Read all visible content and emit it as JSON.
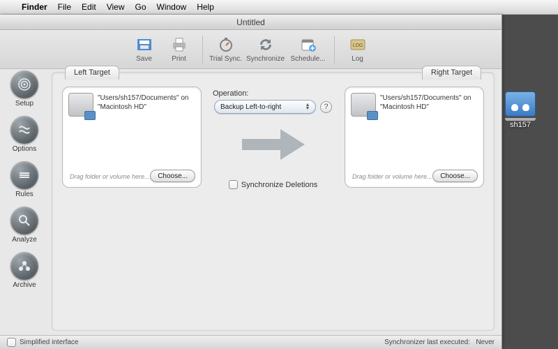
{
  "menubar": {
    "app": "Finder",
    "items": [
      "File",
      "Edit",
      "View",
      "Go",
      "Window",
      "Help"
    ]
  },
  "window": {
    "title": "Untitled"
  },
  "toolbar": {
    "save": "Save",
    "print": "Print",
    "trial": "Trial Sync.",
    "sync": "Synchronize",
    "schedule": "Schedule...",
    "log": "Log"
  },
  "sidebar": {
    "items": [
      {
        "label": "Setup"
      },
      {
        "label": "Options"
      },
      {
        "label": "Rules"
      },
      {
        "label": "Analyze"
      },
      {
        "label": "Archive"
      }
    ]
  },
  "tabs": {
    "left": "Left Target",
    "right": "Right Target"
  },
  "target": {
    "left": {
      "path": "\"Users/sh157/Documents\" on \"Macintosh HD\"",
      "hint": "Drag folder or volume here...",
      "choose": "Choose..."
    },
    "right": {
      "path": "\"Users/sh157/Documents\" on \"Macintosh HD\"",
      "hint": "Drag folder or volume here...",
      "choose": "Choose..."
    }
  },
  "operation": {
    "label": "Operation:",
    "selected": "Backup Left-to-right",
    "sync_del": "Synchronize Deletions"
  },
  "statusbar": {
    "simplified": "Simplified interface",
    "last_label": "Synchronizer last executed:",
    "last_value": "Never"
  },
  "desktop": {
    "share_label": "sh157"
  }
}
